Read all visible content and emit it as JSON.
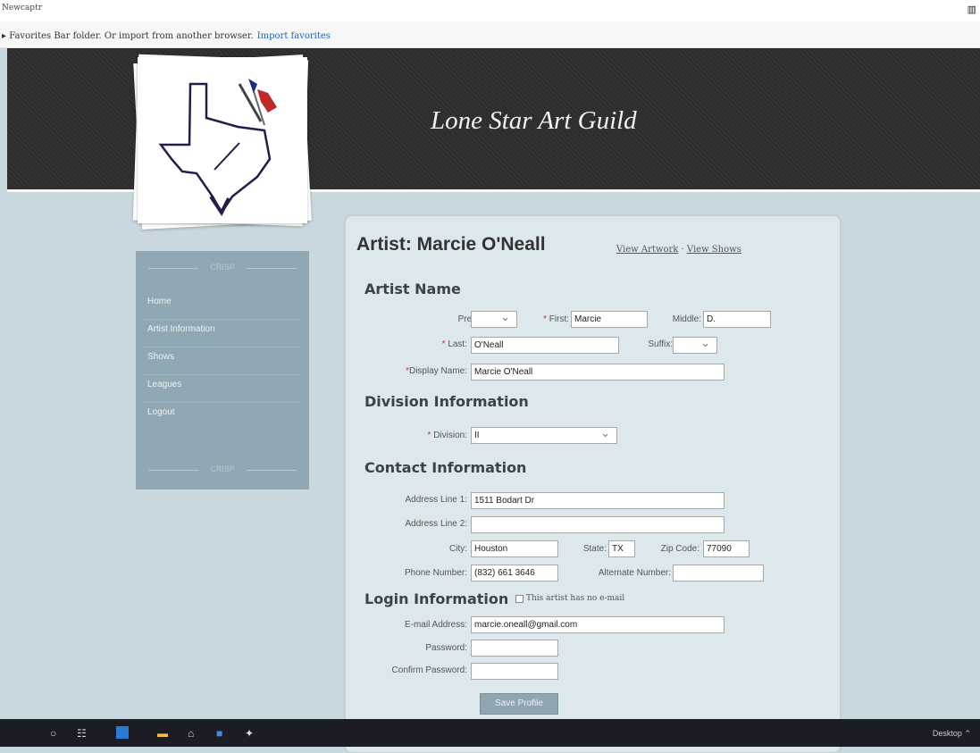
{
  "browser": {
    "window_title": "Newcaptr",
    "favorites_text": "Favorites Bar folder. Or import from another browser.",
    "favorites_link": "Import favorites"
  },
  "header": {
    "site_title": "Lone Star Art Guild"
  },
  "sidebar": {
    "ornament": "CRISP",
    "items": [
      {
        "label": "Home"
      },
      {
        "label": "Artist Information"
      },
      {
        "label": "Shows"
      },
      {
        "label": "Leagues"
      },
      {
        "label": "Logout"
      }
    ]
  },
  "page": {
    "title": "Artist: Marcie O'Neall",
    "link_artwork": "View Artwork",
    "link_sep": "·",
    "link_shows": "View Shows"
  },
  "artist_name": {
    "heading": "Artist Name",
    "prefix_label": "Prefix:",
    "prefix_value": "",
    "first_label": "First:",
    "first_value": "Marcie",
    "middle_label": "Middle:",
    "middle_value": "D.",
    "last_label": "Last:",
    "last_value": "O'Neall",
    "suffix_label": "Suffix:",
    "suffix_value": "",
    "display_label": "Display Name:",
    "display_value": "Marcie O'Neall"
  },
  "division": {
    "heading": "Division Information",
    "label": "Division:",
    "value": "II"
  },
  "contact": {
    "heading": "Contact Information",
    "addr1_label": "Address Line 1:",
    "addr1_value": "1511 Bodart Dr",
    "addr2_label": "Address Line 2:",
    "addr2_value": "",
    "city_label": "City:",
    "city_value": "Houston",
    "state_label": "State:",
    "state_value": "TX",
    "zip_label": "Zip Code:",
    "zip_value": "77090",
    "phone_label": "Phone Number:",
    "phone_value": "(832) 661 3646",
    "alt_label": "Alternate Number:",
    "alt_value": ""
  },
  "login": {
    "heading": "Login Information",
    "no_email_label": "This artist has no e-mail",
    "email_label": "E-mail Address:",
    "email_value": "marcie.oneall@gmail.com",
    "password_label": "Password:",
    "confirm_label": "Confirm Password:"
  },
  "actions": {
    "save_label": "Save Profile"
  },
  "taskbar": {
    "right_text": "Desktop"
  },
  "colors": {
    "header_bg": "#2c2c2c",
    "page_bg": "#c9d8de",
    "panel_bg": "#dde8ec",
    "sidebar_bg": "#90a8b3",
    "required": "#cc3333"
  }
}
